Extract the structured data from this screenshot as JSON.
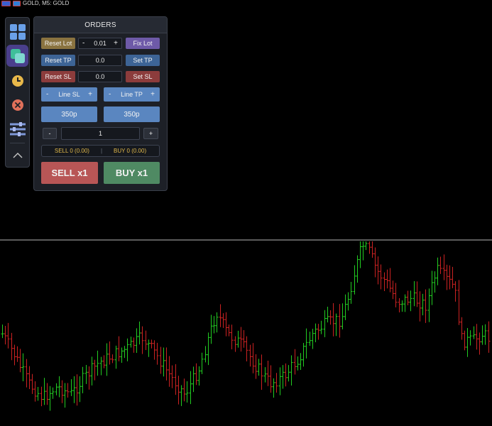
{
  "window": {
    "title": "GOLD, M5:  GOLD"
  },
  "sidebar": {
    "items": [
      {
        "icon": "grid-icon"
      },
      {
        "icon": "layers-icon",
        "active": true
      },
      {
        "icon": "clock-icon"
      },
      {
        "icon": "close-circle-icon"
      },
      {
        "icon": "sliders-icon"
      },
      {
        "icon": "chevron-up-icon"
      }
    ]
  },
  "panel": {
    "title": "ORDERS",
    "reset_lot": "Reset Lot",
    "lot_minus": "-",
    "lot_value": "0.01",
    "lot_plus": "+",
    "fix_lot": "Fix Lot",
    "reset_tp": "Reset TP",
    "tp_value": "0.0",
    "set_tp": "Set TP",
    "reset_sl": "Reset SL",
    "sl_value": "0.0",
    "set_sl": "Set SL",
    "line_sl": {
      "minus": "-",
      "label": "Line SL",
      "plus": "+"
    },
    "line_tp": {
      "minus": "-",
      "label": "Line TP",
      "plus": "+"
    },
    "sl_points": "350p",
    "tp_points": "350p",
    "qty_minus": "-",
    "qty_value": "1",
    "qty_plus": "+",
    "sell_info": "SELL 0 (0.00)",
    "info_divider": "|",
    "buy_info": "BUY 0 (0.00)",
    "sell_button": "SELL x1",
    "buy_button": "BUY x1"
  },
  "colors": {
    "background": "#000000",
    "bull_bar": "#22cc22",
    "bear_bar": "#cc2222",
    "price_line": "#b9b9b9",
    "accent": "#6e5aa8"
  }
}
